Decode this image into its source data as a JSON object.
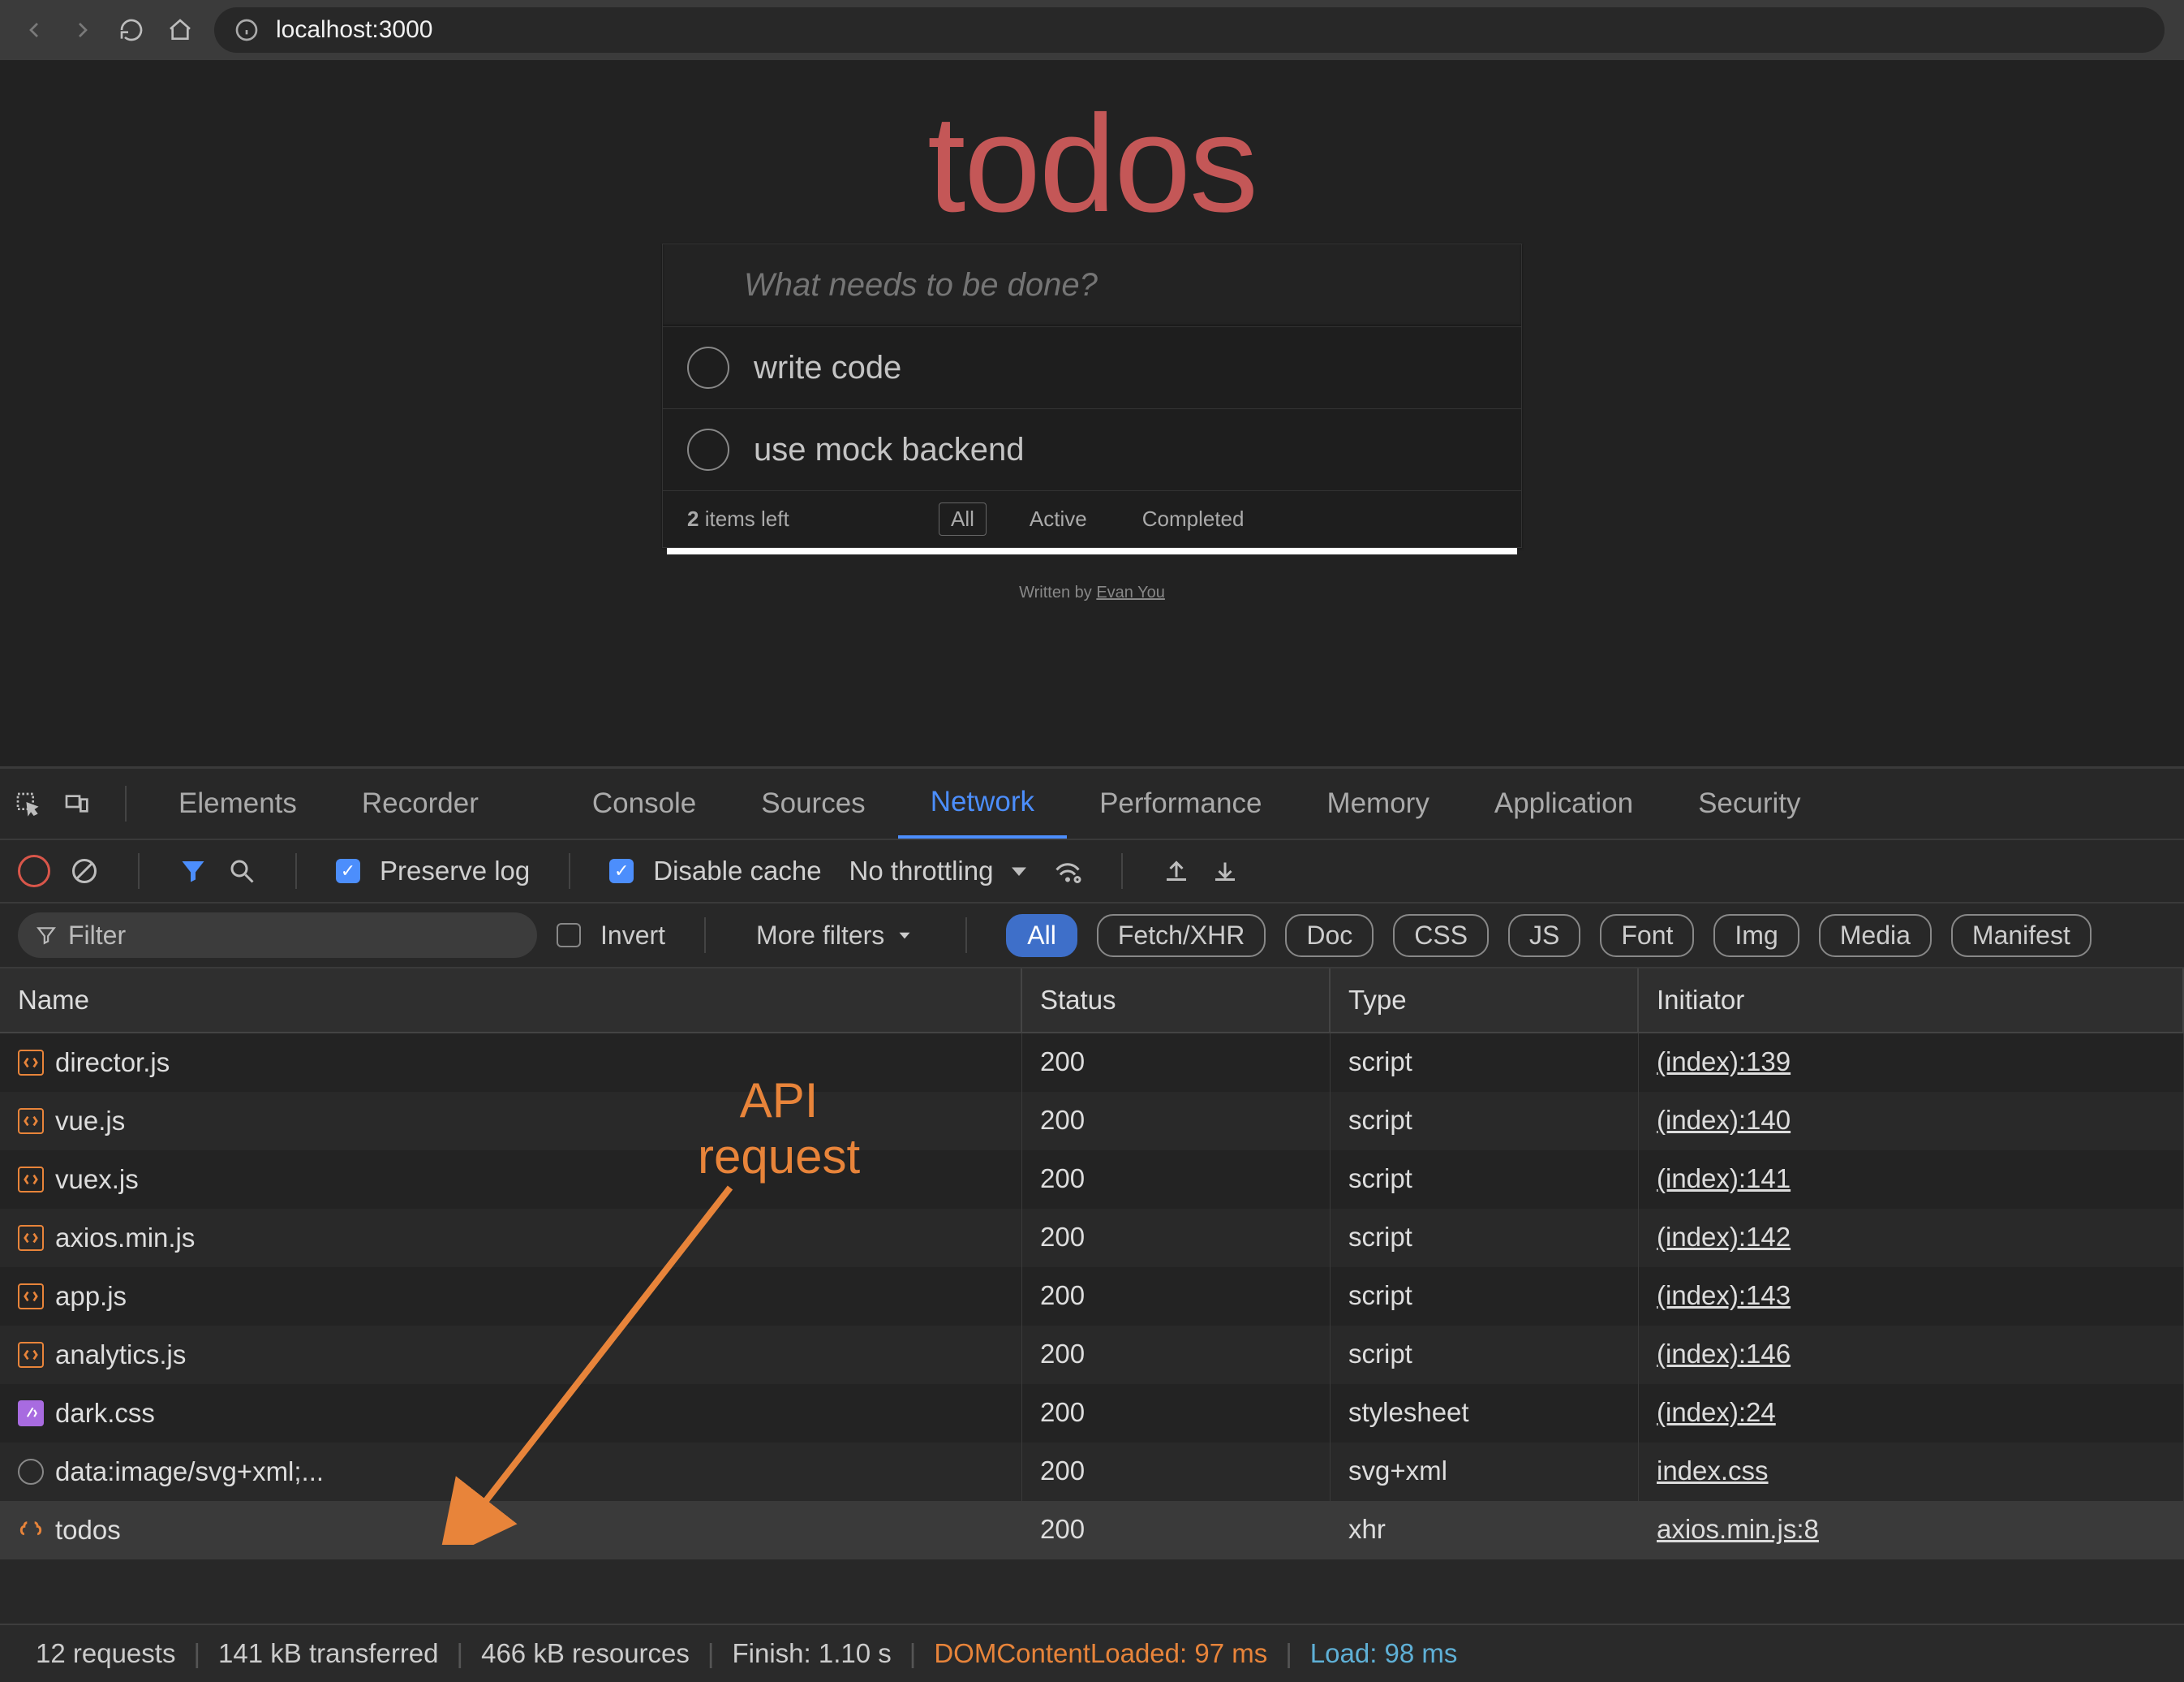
{
  "browser": {
    "url": "localhost:3000"
  },
  "app": {
    "title": "todos",
    "placeholder": "What needs to be done?",
    "items": [
      {
        "label": "write code"
      },
      {
        "label": "use mock backend"
      }
    ],
    "items_left_count": "2",
    "items_left_suffix": " items left",
    "filters": {
      "all": "All",
      "active": "Active",
      "completed": "Completed"
    },
    "credit_prefix": "Written by ",
    "credit_author": "Evan You"
  },
  "devtools": {
    "tabs": {
      "elements": "Elements",
      "recorder": "Recorder",
      "console": "Console",
      "sources": "Sources",
      "network": "Network",
      "performance": "Performance",
      "memory": "Memory",
      "application": "Application",
      "security": "Security"
    },
    "toolbar": {
      "preserve_log": "Preserve log",
      "disable_cache": "Disable cache",
      "throttling": "No throttling"
    },
    "filterbar": {
      "filter_placeholder": "Filter",
      "invert": "Invert",
      "more_filters": "More filters",
      "types": {
        "all": "All",
        "fetchxhr": "Fetch/XHR",
        "doc": "Doc",
        "css": "CSS",
        "js": "JS",
        "font": "Font",
        "img": "Img",
        "media": "Media",
        "manifest": "Manifest"
      }
    },
    "columns": {
      "name": "Name",
      "status": "Status",
      "type": "Type",
      "initiator": "Initiator"
    },
    "rows": [
      {
        "icon": "js",
        "name": "director.js",
        "status": "200",
        "type": "script",
        "initiator": "(index):139",
        "dim": false
      },
      {
        "icon": "js",
        "name": "vue.js",
        "status": "200",
        "type": "script",
        "initiator": "(index):140",
        "dim": false
      },
      {
        "icon": "js",
        "name": "vuex.js",
        "status": "200",
        "type": "script",
        "initiator": "(index):141",
        "dim": false
      },
      {
        "icon": "js",
        "name": "axios.min.js",
        "status": "200",
        "type": "script",
        "initiator": "(index):142",
        "dim": false
      },
      {
        "icon": "js",
        "name": "app.js",
        "status": "200",
        "type": "script",
        "initiator": "(index):143",
        "dim": false
      },
      {
        "icon": "js",
        "name": "analytics.js",
        "status": "200",
        "type": "script",
        "initiator": "(index):146",
        "dim": false
      },
      {
        "icon": "css",
        "name": "dark.css",
        "status": "200",
        "type": "stylesheet",
        "initiator": "(index):24",
        "dim": false
      },
      {
        "icon": "svg",
        "name": "data:image/svg+xml;...",
        "status": "200",
        "type": "svg+xml",
        "initiator": "index.css",
        "dim": true
      },
      {
        "icon": "xhr",
        "name": "todos",
        "status": "200",
        "type": "xhr",
        "initiator": "axios.min.js:8",
        "dim": false,
        "hl": true
      }
    ],
    "status": {
      "requests": "12 requests",
      "transferred": "141 kB transferred",
      "resources": "466 kB resources",
      "finish": "Finish: 1.10 s",
      "dcl": "DOMContentLoaded: 97 ms",
      "load": "Load: 98 ms"
    }
  },
  "annotation": {
    "line1": "API",
    "line2": "request"
  }
}
